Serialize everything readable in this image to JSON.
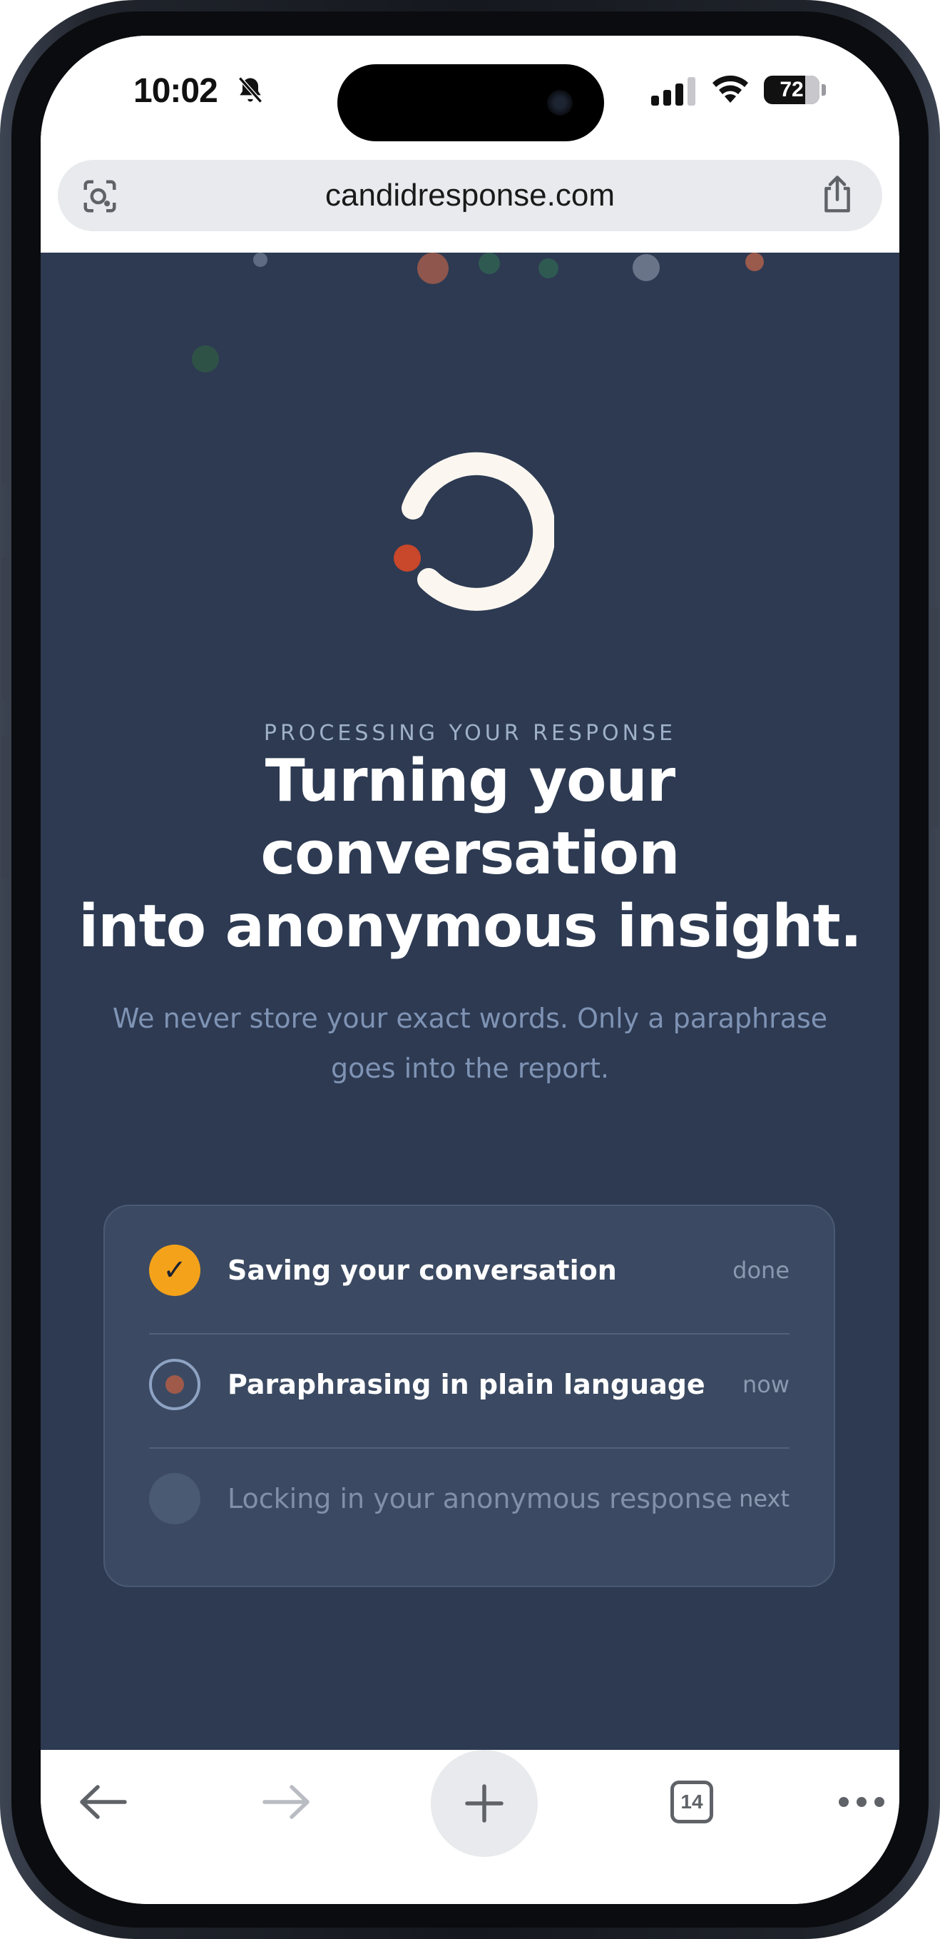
{
  "status_bar": {
    "time": "10:02",
    "battery": "72",
    "icons": [
      "bell-slash-icon",
      "cellular-signal-icon",
      "wifi-icon",
      "battery-icon"
    ]
  },
  "browser": {
    "url": "candidresponse.com",
    "left_icon": "lens-icon",
    "right_icon": "share-icon"
  },
  "page": {
    "eyebrow": "PROCESSING YOUR RESPONSE",
    "headline_lines": [
      "Turning your",
      "conversation",
      "into anonymous insight."
    ],
    "subtext": "We never store your exact words. Only a paraphrase goes into the report.",
    "steps": [
      {
        "label": "Saving your conversation",
        "status": "done",
        "state": "done"
      },
      {
        "label": "Paraphrasing in plain language",
        "status": "now",
        "state": "now"
      },
      {
        "label": "Locking in your anonymous response",
        "status": "next",
        "state": "next"
      }
    ],
    "colors": {
      "background": "#2d3a52",
      "accent_orange": "#f5a21b",
      "accent_red": "#c9472b",
      "spinner": "#fbf7f0"
    }
  },
  "toolbar": {
    "tabs_count": "14",
    "icons": [
      "back-arrow-icon",
      "forward-arrow-icon",
      "plus-icon",
      "tabs-icon",
      "more-icon"
    ]
  }
}
